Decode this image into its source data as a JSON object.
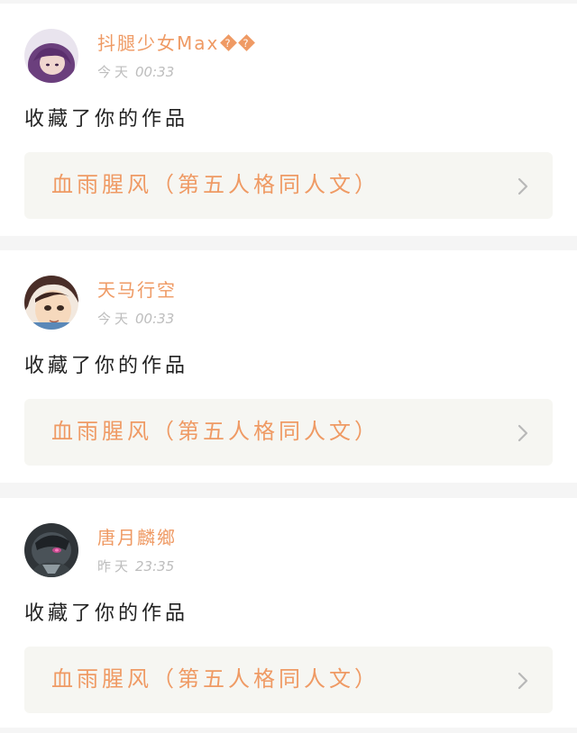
{
  "feed": {
    "items": [
      {
        "user_name": "抖腿少女Max",
        "name_badges": [
          "?",
          "?"
        ],
        "day": "今天",
        "time": "00:33",
        "action_text": "收藏了你的作品",
        "work_title": "血雨腥风（第五人格同人文）",
        "avatar_icon": "avatar-purple-hair-icon"
      },
      {
        "user_name": "天马行空",
        "day": "今天",
        "time": "00:33",
        "action_text": "收藏了你的作品",
        "work_title": "血雨腥风（第五人格同人文）",
        "avatar_icon": "avatar-anime-boy-icon"
      },
      {
        "user_name": "唐月麟鄉",
        "day": "昨天",
        "time": "23:35",
        "action_text": "收藏了你的作品",
        "work_title": "血雨腥风（第五人格同人文）",
        "avatar_icon": "avatar-dark-character-icon"
      }
    ]
  },
  "colors": {
    "accent": "#ef9a64",
    "meta_text": "#bdbdbd",
    "body_text": "#222222",
    "link_bg": "#f6f6f2",
    "page_bg": "#f5f5f5"
  }
}
